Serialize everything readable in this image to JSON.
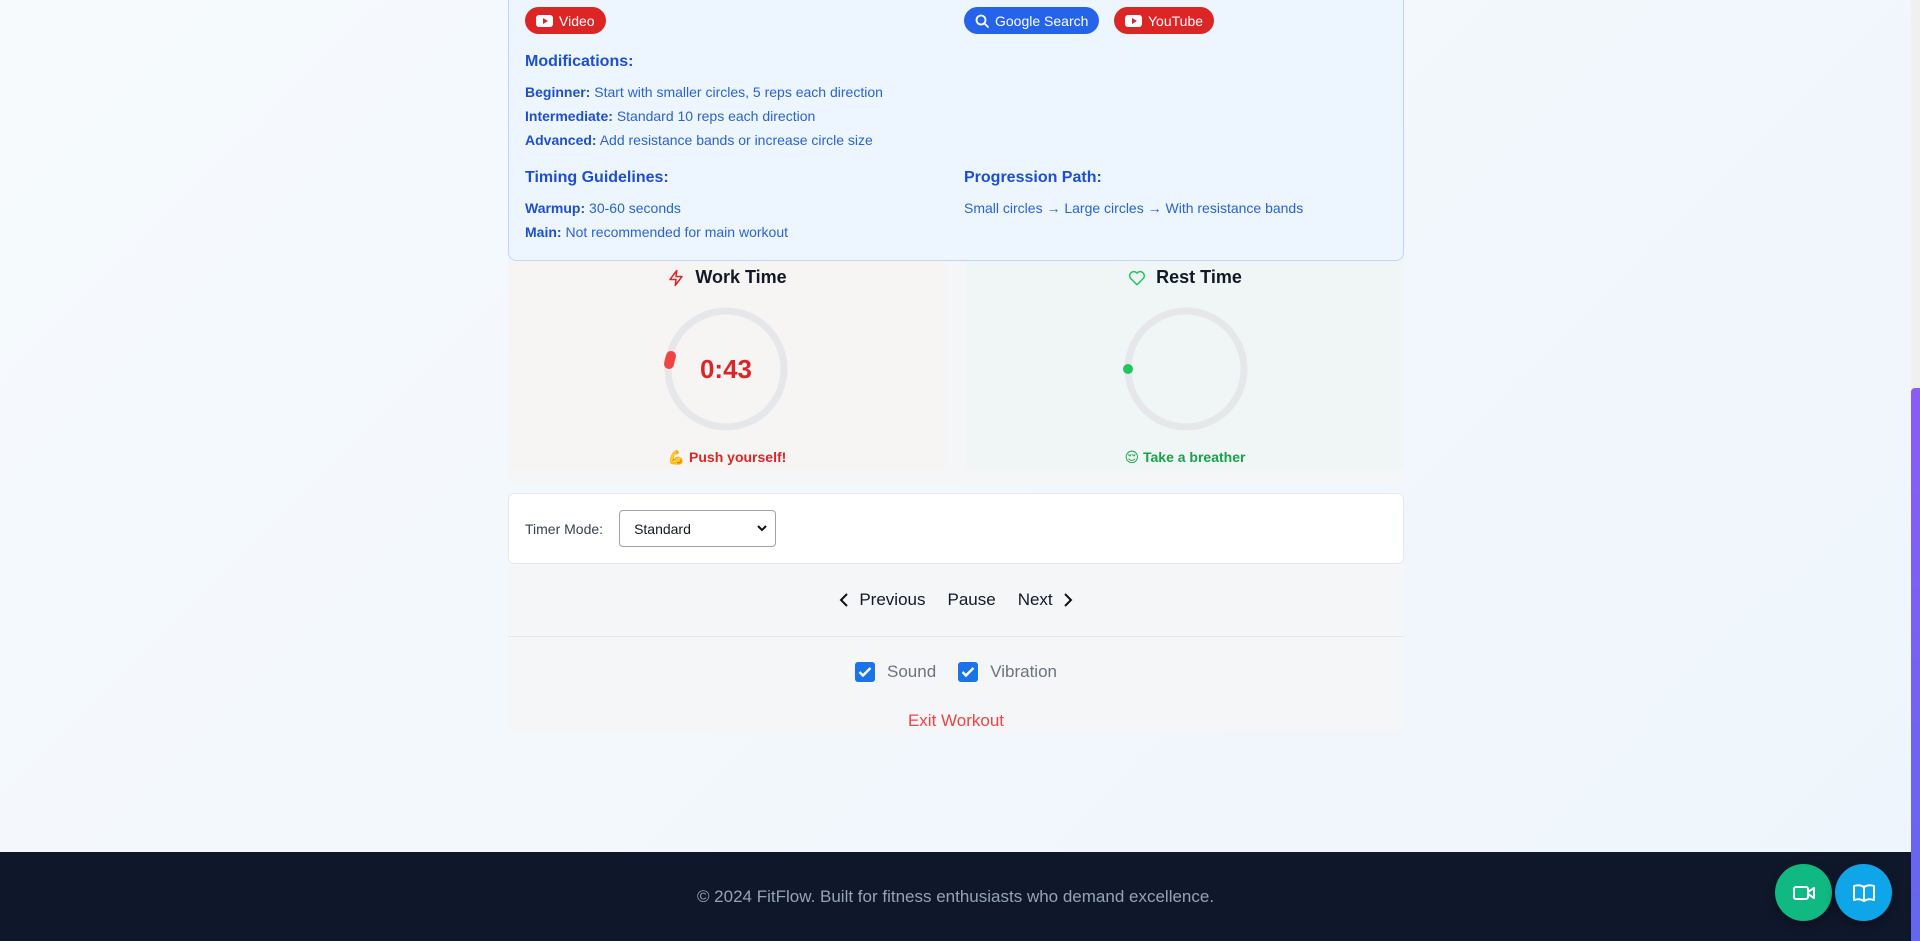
{
  "resources": {
    "video_label": "Video",
    "google_label": "Google Search",
    "youtube_label": "YouTube"
  },
  "modifications": {
    "title": "Modifications:",
    "items": [
      {
        "level": "Beginner:",
        "text": "Start with smaller circles, 5 reps each direction"
      },
      {
        "level": "Intermediate:",
        "text": "Standard 10 reps each direction"
      },
      {
        "level": "Advanced:",
        "text": "Add resistance bands or increase circle size"
      }
    ]
  },
  "timing": {
    "title": "Timing Guidelines:",
    "items": [
      {
        "label": "Warmup:",
        "text": "30-60 seconds"
      },
      {
        "label": "Main:",
        "text": "Not recommended for main workout"
      }
    ]
  },
  "progression": {
    "title": "Progression Path:",
    "text": "Small circles → Large circles → With resistance bands"
  },
  "work_timer": {
    "title": "Work Time",
    "time": "0:43",
    "message": "💪 Push yourself!",
    "color": "#dc2626"
  },
  "rest_timer": {
    "title": "Rest Time",
    "message": "😌 Take a breather",
    "color": "#22c55e"
  },
  "timer_mode": {
    "label": "Timer Mode:",
    "selected": "Standard"
  },
  "controls": {
    "previous": "Previous",
    "pause": "Pause",
    "next": "Next"
  },
  "settings": {
    "sound": "Sound",
    "vibration": "Vibration",
    "exit": "Exit Workout"
  },
  "footer": {
    "text": "© 2024 FitFlow. Built for fitness enthusiasts who demand excellence."
  },
  "icons": {
    "video": "youtube-icon",
    "search": "search-icon",
    "work": "lightning-icon",
    "rest": "heart-icon",
    "fab_video": "video-camera-icon",
    "fab_book": "book-icon"
  }
}
